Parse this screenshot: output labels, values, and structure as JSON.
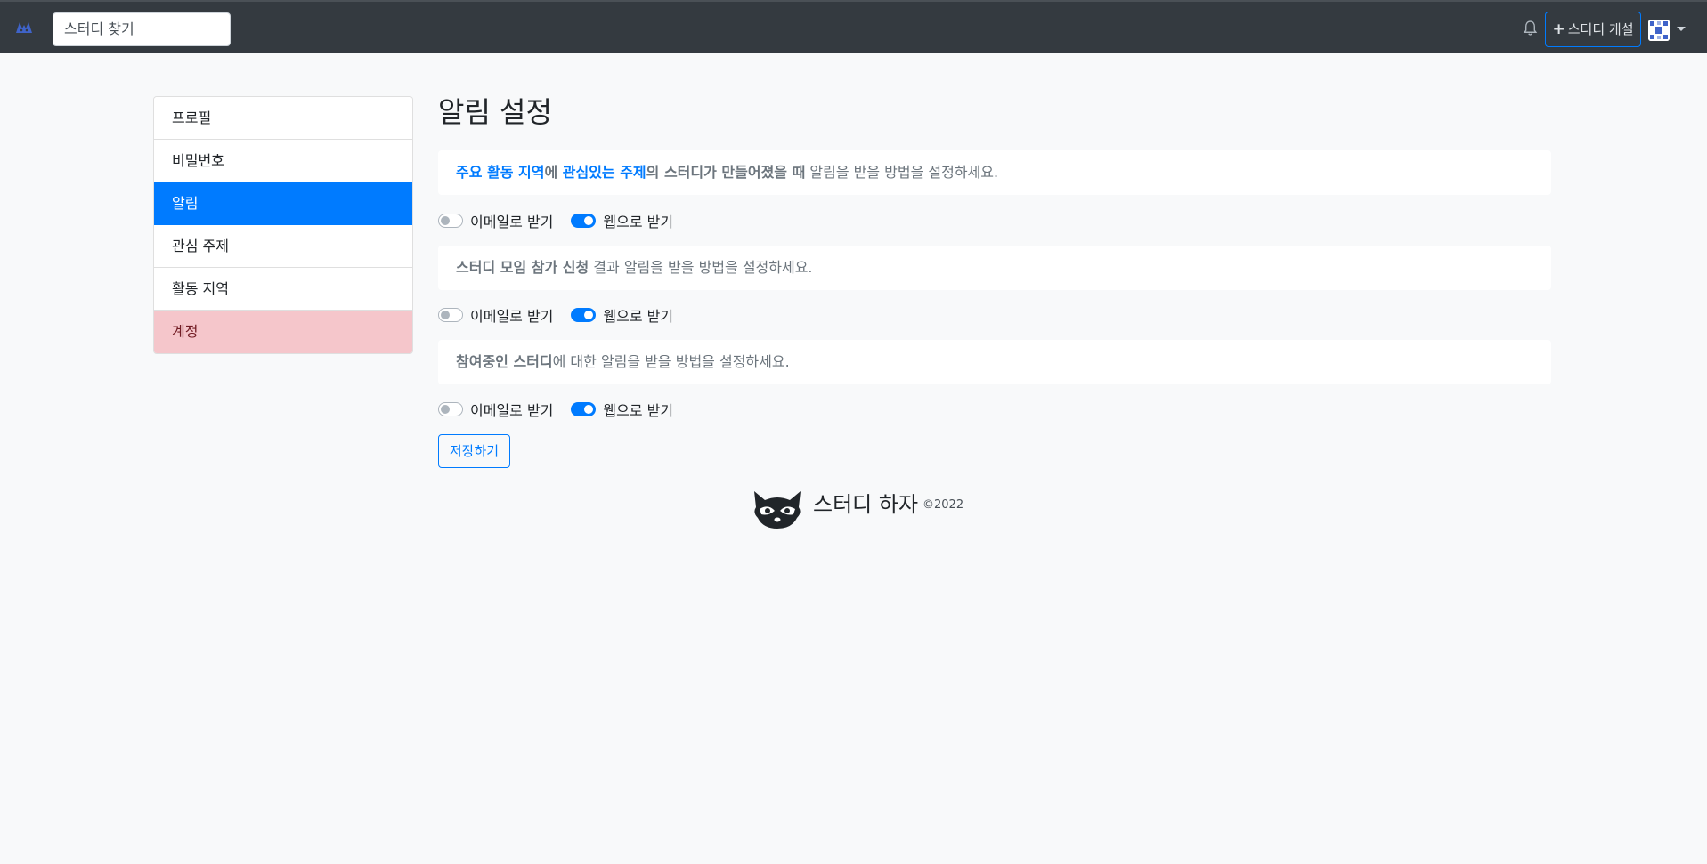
{
  "navbar": {
    "brand_icon": "raccoon-logo-icon",
    "search_value": "스터디 찾기",
    "bell_icon": "bell-icon",
    "open_study_label": "스터디 개설",
    "open_study_icon": "plus-icon",
    "avatar_icon": "identicon-avatar",
    "menu_icon": "caret-down-icon"
  },
  "sidebar": {
    "items": [
      {
        "label": "프로필"
      },
      {
        "label": "비밀번호"
      },
      {
        "label": "알림"
      },
      {
        "label": "관심 주제"
      },
      {
        "label": "활동 지역"
      },
      {
        "label": "계정"
      }
    ],
    "active_index": 2
  },
  "main": {
    "title": "알림 설정",
    "sections": [
      {
        "parts": [
          "주요 활동 지역",
          "에 ",
          "관심있는 주제",
          "의 ",
          "스터디가 만들어졌을 때",
          " 알림을 받을 방법을 설정하세요."
        ],
        "email_label": "이메일로 받기",
        "email_on": false,
        "web_label": "웹으로 받기",
        "web_on": true
      },
      {
        "parts": [
          "스터디 모임 참가 신청",
          " 결과 알림을 받을 방법을 설정하세요."
        ],
        "email_label": "이메일로 받기",
        "email_on": false,
        "web_label": "웹으로 받기",
        "web_on": true
      },
      {
        "parts": [
          "참여중인 스터디",
          "에 대한 알림을 받을 방법을 설정하세요."
        ],
        "email_label": "이메일로 받기",
        "email_on": false,
        "web_label": "웹으로 받기",
        "web_on": true
      }
    ],
    "save_label": "저장하기"
  },
  "footer": {
    "logo_icon": "raccoon-logo-icon",
    "title": "스터디 하자",
    "copyright": "©2022"
  },
  "colors": {
    "navbar_bg": "#343a40",
    "primary": "#007bff",
    "danger_bg": "#f5c6cb",
    "page_bg": "#f8f9fa"
  }
}
